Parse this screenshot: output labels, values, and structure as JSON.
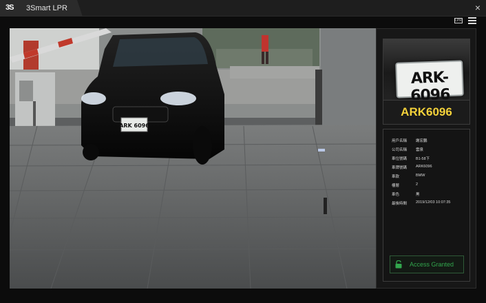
{
  "window": {
    "logo_text": "3S",
    "app_title": "3Smart LPR",
    "close_glyph": "×"
  },
  "toolbar": {
    "icon1_label": "LPR",
    "icon2": "list-icon"
  },
  "camera": {
    "scene": "parking-gate-camera-feed",
    "vehicle_plate_text": "ARK 6096"
  },
  "panel": {
    "plate_thumb_text": "ARK-6096",
    "plate_number": "ARK6096",
    "fields": [
      {
        "label": "用戶名稱",
        "value": "謝宏鵬"
      },
      {
        "label": "公司名稱",
        "value": "雲泉"
      },
      {
        "label": "車位號碼",
        "value": "B1-58下"
      },
      {
        "label": "車牌號碼",
        "value": "ARK6096"
      },
      {
        "label": "車款",
        "value": "BMW"
      },
      {
        "label": "樓層",
        "value": "2"
      },
      {
        "label": "車色",
        "value": "黑"
      },
      {
        "label": "最後時間",
        "value": "2019/12/03 10:07:35"
      }
    ],
    "access_status": "Access Granted",
    "access_color": "#32a64d",
    "plate_color": "#f3d13a"
  }
}
